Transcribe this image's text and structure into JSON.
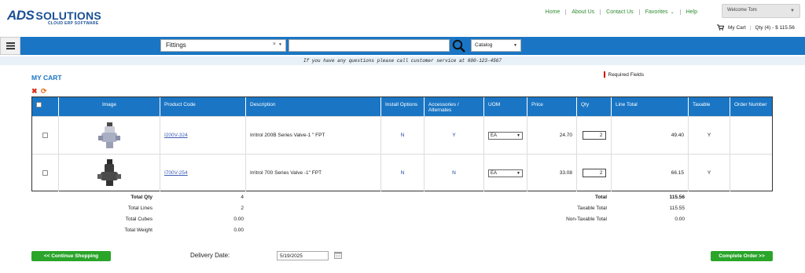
{
  "brand": {
    "logo_main": "ADS",
    "logo_solutions": "SOLUTIONS",
    "logo_sub": "CLOUD ERP SOFTWARE"
  },
  "nav": {
    "home": "Home",
    "about": "About Us",
    "contact": "Contact Us",
    "favorites": "Favorites",
    "help": "Help"
  },
  "user": {
    "welcome": "Welcome Tom",
    "my_cart": "My Cart",
    "cart_summary": "Qty (4) - $ 115.56"
  },
  "search": {
    "category_value": "Fittings",
    "query_value": "",
    "scope_value": "Catalog"
  },
  "info_message": "If you have any questions please call customer service at 800-123-4567",
  "cart": {
    "title": "MY CART",
    "required_note": "Required Fields",
    "columns": {
      "image": "Image",
      "product_code": "Product Code",
      "description": "Description",
      "install": "Install Options",
      "accessories": "Accessories / Alternates",
      "uom": "UOM",
      "price": "Price",
      "qty": "Qty",
      "line_total": "Line Total",
      "taxable": "Taxable",
      "order_number": "Order Number"
    },
    "rows": [
      {
        "code": "I200V-324",
        "description": "Irritrol 200B Series Valve-1 \" FPT",
        "install": "N",
        "accessories": "Y",
        "uom": "EA",
        "price": "24.70",
        "qty": "2",
        "line_total": "49.40",
        "taxable": "Y",
        "order_number": ""
      },
      {
        "code": "I700V-254",
        "description": "Irritrol 700 Series Valve -1\" FPT",
        "install": "N",
        "accessories": "N",
        "uom": "EA",
        "price": "33.08",
        "qty": "2",
        "line_total": "66.15",
        "taxable": "Y",
        "order_number": ""
      }
    ]
  },
  "totals_left": {
    "total_qty_label": "Total Qty",
    "total_qty": "4",
    "total_lines_label": "Total Lines",
    "total_lines": "2",
    "total_cubes_label": "Total Cubes",
    "total_cubes": "0.00",
    "total_weight_label": "Total Weight",
    "total_weight": "0.00"
  },
  "totals_right": {
    "total_label": "Total",
    "total": "115.56",
    "taxable_label": "Taxable Total",
    "taxable": "115.55",
    "nontaxable_label": "Non-Taxable Total",
    "nontaxable": "0.00"
  },
  "footer": {
    "continue_label": "<< Continue Shopping",
    "delivery_label": "Delivery Date:",
    "delivery_value": "5/19/2025",
    "complete_label": "Complete Order >>"
  },
  "colors": {
    "primary_blue": "#1a76c4",
    "green": "#2aa52a",
    "link_green": "#2e8b2e"
  }
}
